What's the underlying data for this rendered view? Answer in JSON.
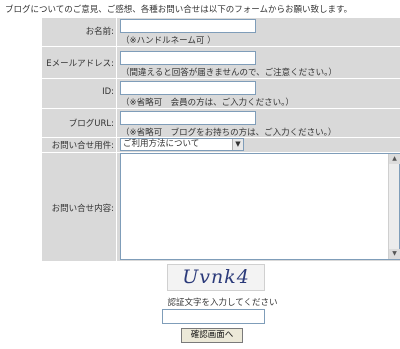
{
  "intro_text": "ブログについてのご意見、ご感想、各種お問い合せは以下のフォームからお願い致します。",
  "form": {
    "name": {
      "label": "お名前:",
      "value": "",
      "note": "（※ハンドルネーム可 ）"
    },
    "email": {
      "label": "Eメールアドレス:",
      "value": "",
      "note": "（間違えると回答が届きませんので、ご注意ください。）"
    },
    "id": {
      "label": "ID:",
      "value": "",
      "note": "（※省略可　会員の方は、ご入力ください。）"
    },
    "blog_url": {
      "label": "ブログURL:",
      "value": "",
      "note": "（※省略可　ブログをお持ちの方は、ご入力ください。）"
    },
    "subject": {
      "label": "お問い合せ用件:",
      "selected": "ご利用方法について"
    },
    "content": {
      "label": "お問い合せ内容:",
      "value": ""
    }
  },
  "captcha": {
    "image_text": "Uvnk4",
    "label": "認証文字を入力してください",
    "value": ""
  },
  "confirm_button": "確認画面へ",
  "colors": {
    "form_bg": "#d9d9d9",
    "input_border": "#7f9db9"
  }
}
